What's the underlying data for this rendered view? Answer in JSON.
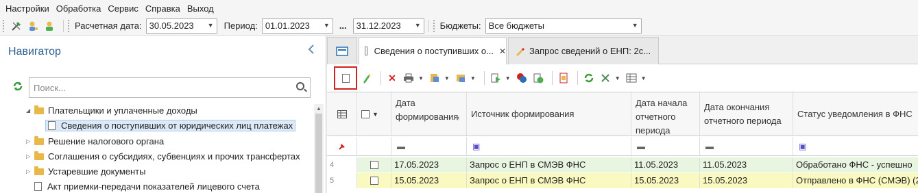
{
  "menu": [
    "Настройки",
    "Обработка",
    "Сервис",
    "Справка",
    "Выход"
  ],
  "toolbar": {
    "calc_date_label": "Расчетная дата:",
    "calc_date_value": "30.05.2023",
    "period_label": "Период:",
    "period_from": "01.01.2023",
    "period_dots": "...",
    "period_to": "31.12.2023",
    "budgets_label": "Бюджеты:",
    "budgets_value": "Все бюджеты"
  },
  "navigator": {
    "title": "Навигатор",
    "search_placeholder": "Поиск...",
    "items": [
      {
        "label": "Плательщики и уплаченные доходы",
        "type": "folder",
        "expanded": true
      },
      {
        "label": "Сведения о поступивших от юридических лиц платежах",
        "type": "doc",
        "selected": true
      },
      {
        "label": "Решение налогового органа",
        "type": "folder"
      },
      {
        "label": "Соглашения о субсидиях, субвенциях и прочих трансфертах",
        "type": "folder"
      },
      {
        "label": "Устаревшие документы",
        "type": "folder"
      },
      {
        "label": "Акт приемки-передачи показателей лицевого счета",
        "type": "doc"
      }
    ]
  },
  "tabs": [
    {
      "label": "Сведения о поступивших о..."
    },
    {
      "label": "Запрос сведений о ЕНП: 2с..."
    }
  ],
  "grid": {
    "headers": {
      "date_formed": "Дата формирования",
      "source": "Источник формирования",
      "period_start": "Дата начала отчетного периода",
      "period_end": "Дата окончания отчетного периода",
      "status": "Статус уведомления в ФНС"
    },
    "rows": [
      {
        "num": "4",
        "date": "17.05.2023",
        "source": "Запрос о ЕНП в СМЭВ ФНС",
        "start": "11.05.2023",
        "end": "11.05.2023",
        "status": "Обработано ФНС - успешно",
        "color": "#e8f5e0"
      },
      {
        "num": "5",
        "date": "15.05.2023",
        "source": "Запрос о ЕНП в СМЭВ ФНС",
        "start": "15.05.2023",
        "end": "15.05.2023",
        "status": "Отправлено в ФНС (СМЭВ) (2",
        "color": "#fafac0"
      }
    ]
  }
}
